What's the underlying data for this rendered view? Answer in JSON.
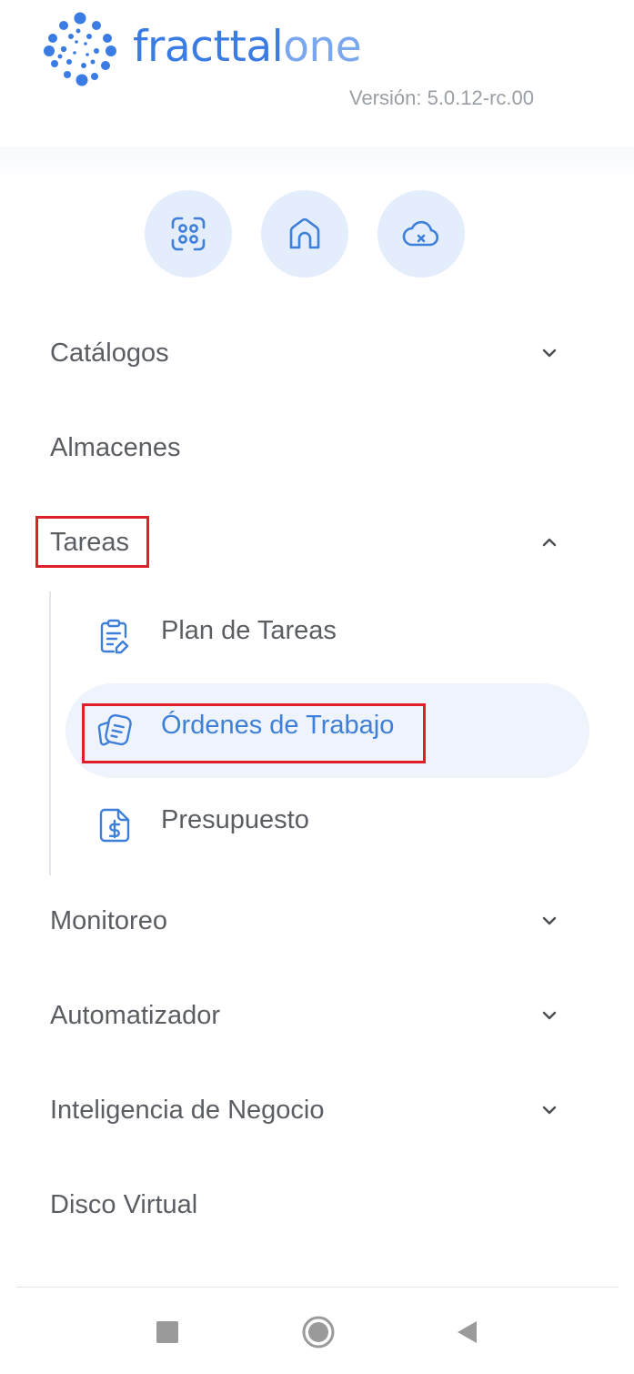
{
  "app": {
    "logo_part1": "fracttal",
    "logo_part2": "one",
    "version": "Versión: 5.0.12-rc.00"
  },
  "quick_actions": [
    {
      "icon": "scan-icon"
    },
    {
      "icon": "home-icon"
    },
    {
      "icon": "cloud-off-icon"
    }
  ],
  "menu": {
    "catalogos": "Catálogos",
    "almacenes": "Almacenes",
    "tareas": "Tareas",
    "monitoreo": "Monitoreo",
    "automatizador": "Automatizador",
    "inteligencia": "Inteligencia de Negocio",
    "disco": "Disco Virtual"
  },
  "tareas_submenu": {
    "plan": "Plan de Tareas",
    "ordenes": "Órdenes de Trabajo",
    "presupuesto": "Presupuesto"
  },
  "colors": {
    "accent": "#3d7fd9",
    "highlight": "#e01f2a",
    "quick_bg": "#e4edfb"
  },
  "navbar": [
    "stop-icon",
    "home-circle-icon",
    "back-triangle-icon"
  ]
}
